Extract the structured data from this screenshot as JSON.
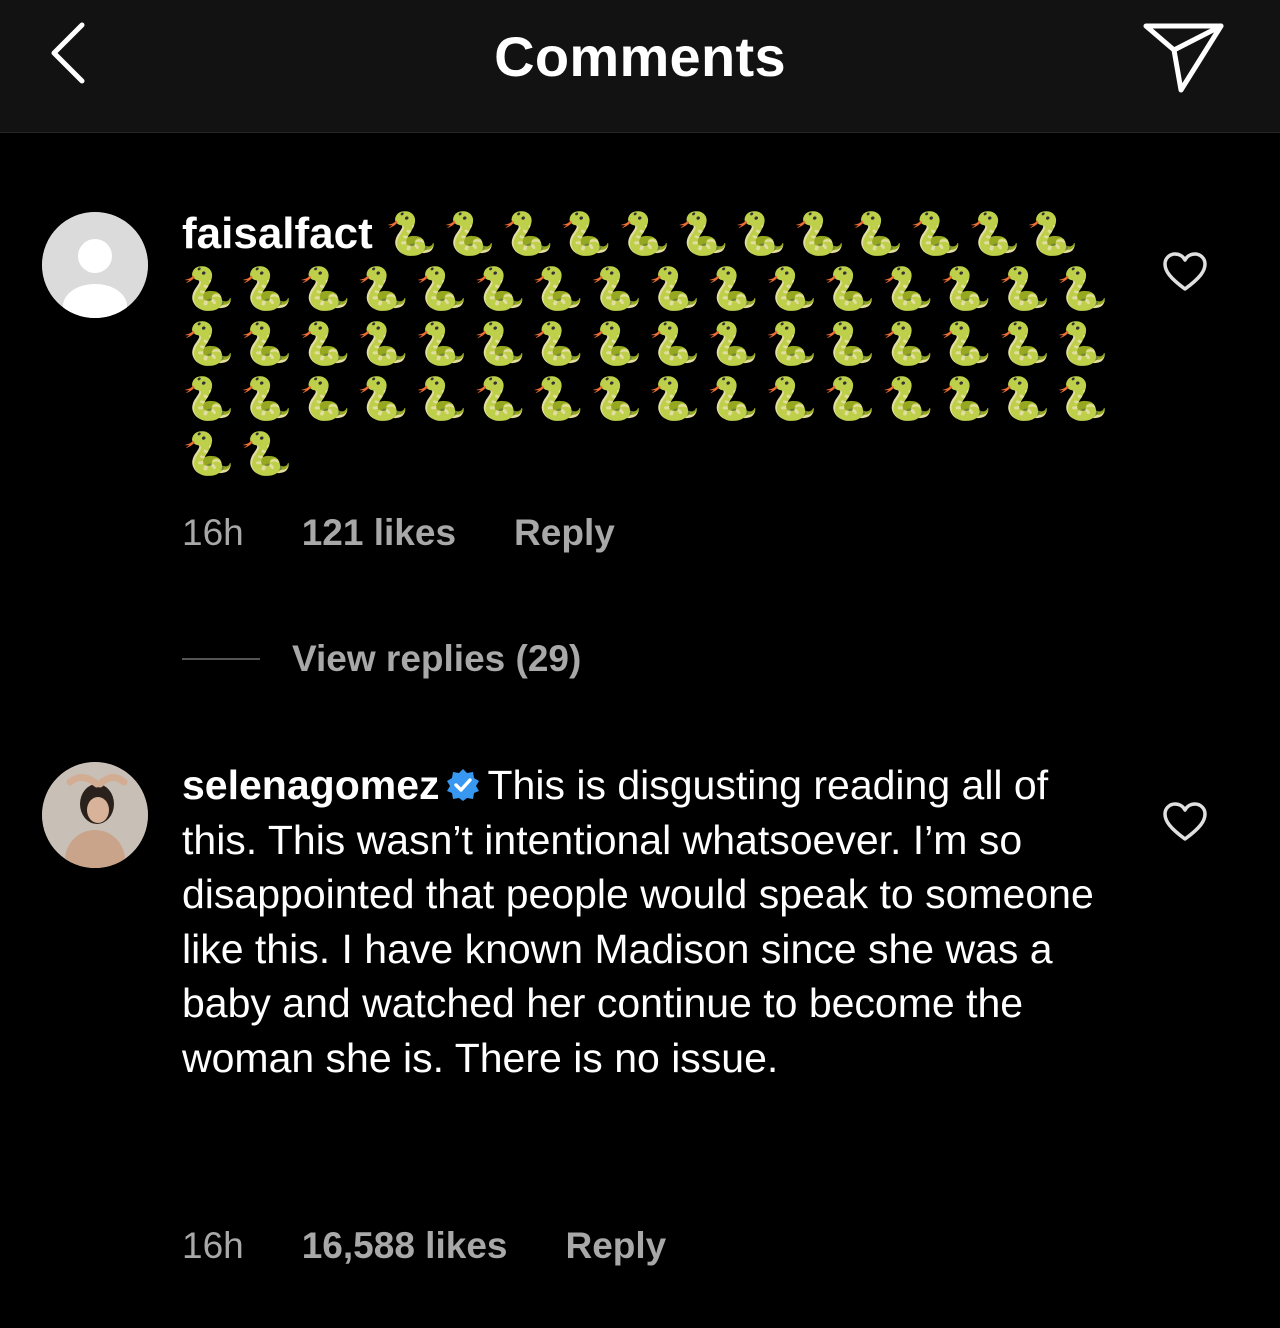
{
  "header": {
    "title": "Comments",
    "back_icon": "chevron-left-icon",
    "share_icon": "paper-plane-icon"
  },
  "colors": {
    "background": "#000000",
    "header_bg": "#121212",
    "text_primary": "#ffffff",
    "text_secondary": "#a8a8a8",
    "verified_blue": "#3897f0"
  },
  "comments": [
    {
      "username": "faisalfact",
      "text": "🐍🐍🐍🐍🐍🐍🐍🐍🐍🐍🐍🐍🐍🐍🐍🐍🐍🐍🐍🐍🐍🐍🐍🐍🐍🐍🐍🐍🐍🐍🐍🐍🐍🐍🐍🐍🐍🐍🐍🐍🐍🐍🐍🐍🐍🐍🐍🐍🐍🐍🐍🐍🐍🐍🐍🐍🐍🐍🐍🐍🐍🐍",
      "time": "16h",
      "likes": "121 likes",
      "reply_label": "Reply",
      "verified": false,
      "view_replies": "View replies (29)"
    },
    {
      "username": "selenagomez",
      "text": "This is disgusting reading all of this. This wasn’t intentional whatsoever. I’m so disappointed that people would speak to someone like this. I have known Madison since she was a baby and watched her continue to become the woman she is. There is no issue.",
      "time": "16h",
      "likes": "16,588 likes",
      "reply_label": "Reply",
      "verified": true
    }
  ]
}
